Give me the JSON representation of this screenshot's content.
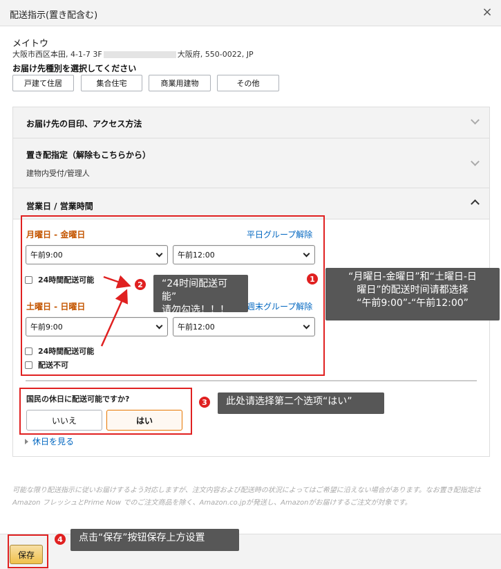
{
  "dialog": {
    "title": "配送指示(置き配含む)",
    "close_label": "×"
  },
  "address": {
    "name": "メイトウ",
    "line_prefix": "大阪市西区本田, 4-1-7 3F",
    "line_suffix": "大阪府, 550-0022, JP"
  },
  "delivery_type": {
    "title": "お届け先種別を選択してください",
    "options": [
      "戸建て住居",
      "集合住宅",
      "商業用建物",
      "その他"
    ]
  },
  "sections": {
    "landmark_title": "お届け先の目印、アクセス方法",
    "okihai_title": "置き配指定（解除もこちらから）",
    "okihai_value": "建物内受付/管理人",
    "hours_title": "営業日 / 営業時間"
  },
  "weekday": {
    "title": "月曜日 - 金曜日",
    "ungroup": "平日グループ解除",
    "from": "午前9:00",
    "to": "午前12:00",
    "allday": "24時間配送可能"
  },
  "weekend": {
    "title": "土曜日 - 日曜日",
    "ungroup": "週末グループ解除",
    "from": "午前9:00",
    "to": "午前12:00",
    "allday": "24時間配送可能",
    "no_delivery": "配送不可"
  },
  "holiday": {
    "question": "国民の休日に配送可能ですか?",
    "no": "いいえ",
    "yes": "はい",
    "selected": "はい",
    "view_link": "休日を見る"
  },
  "footnote": "可能な限り配送指示に従いお届けするよう対応しますが、注文内容および配送時の状況によってはご希望に沿えない場合があります。なお置き配指定はAmazon フレッシュとPrime Now でのご注文商品を除く、Amazon.co.jpが発送し、Amazonがお届けするご注文が対象です。",
  "save_label": "保存",
  "annotations": {
    "colors": {
      "box": "#e02020",
      "callout_bg": "#575757"
    },
    "n1": "1",
    "n2": "2",
    "n3": "3",
    "n4": "4",
    "c1_line1": "“月曜日-金曜日”和“土曜日-日",
    "c1_line2": "曜日”的配送时间请都选择",
    "c1_line3": "“午前9:00”-“午前12:00”",
    "c2_line1": "“24时间配送可能”",
    "c2_line2": "请勿勾选！！！",
    "c3": "此处请选择第二个选项“はい”",
    "c4": "点击“保存”按钮保存上方设置"
  }
}
